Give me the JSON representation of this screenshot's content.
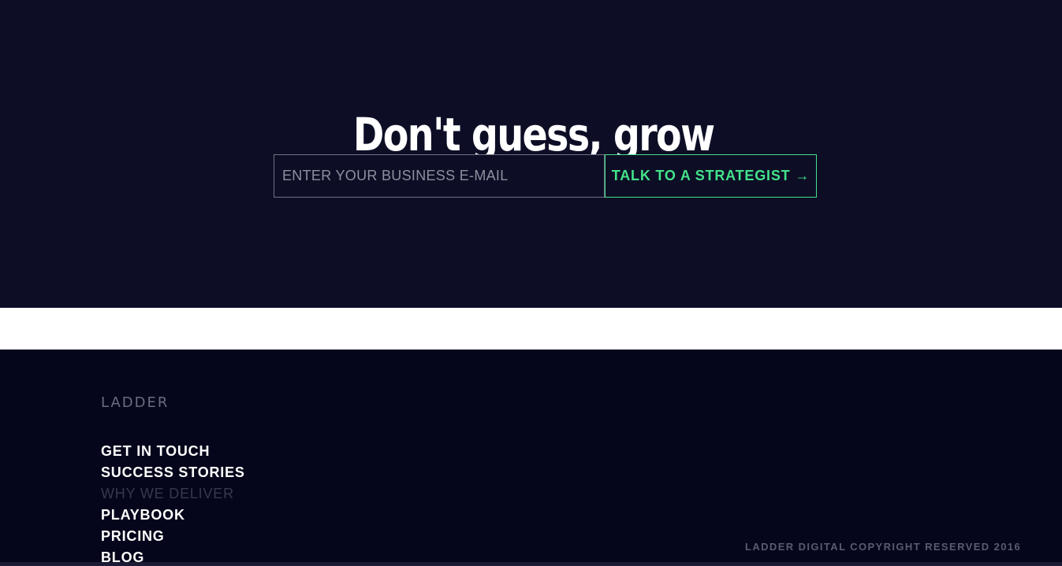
{
  "hero": {
    "title": "Don't guess, grow",
    "email_placeholder": "ENTER YOUR BUSINESS E-MAIL",
    "cta_label": "TALK TO A STRATEGIST",
    "cta_arrow": "→"
  },
  "footer": {
    "logo": "LADDER",
    "nav": [
      {
        "label": "GET IN TOUCH"
      },
      {
        "label": "SUCCESS STORIES"
      },
      {
        "label": "WHY WE DELIVER"
      },
      {
        "label": "PLAYBOOK"
      },
      {
        "label": "PRICING"
      },
      {
        "label": "BLOG"
      }
    ],
    "active_item": "WHY WE DELIVER",
    "copyright": "LADDER DIGITAL COPYRIGHT RESERVED 2016"
  },
  "colors": {
    "hero_bg": "#0d0e26",
    "footer_bg": "#05061b",
    "accent": "#43e28a",
    "muted_text": "#363850"
  }
}
